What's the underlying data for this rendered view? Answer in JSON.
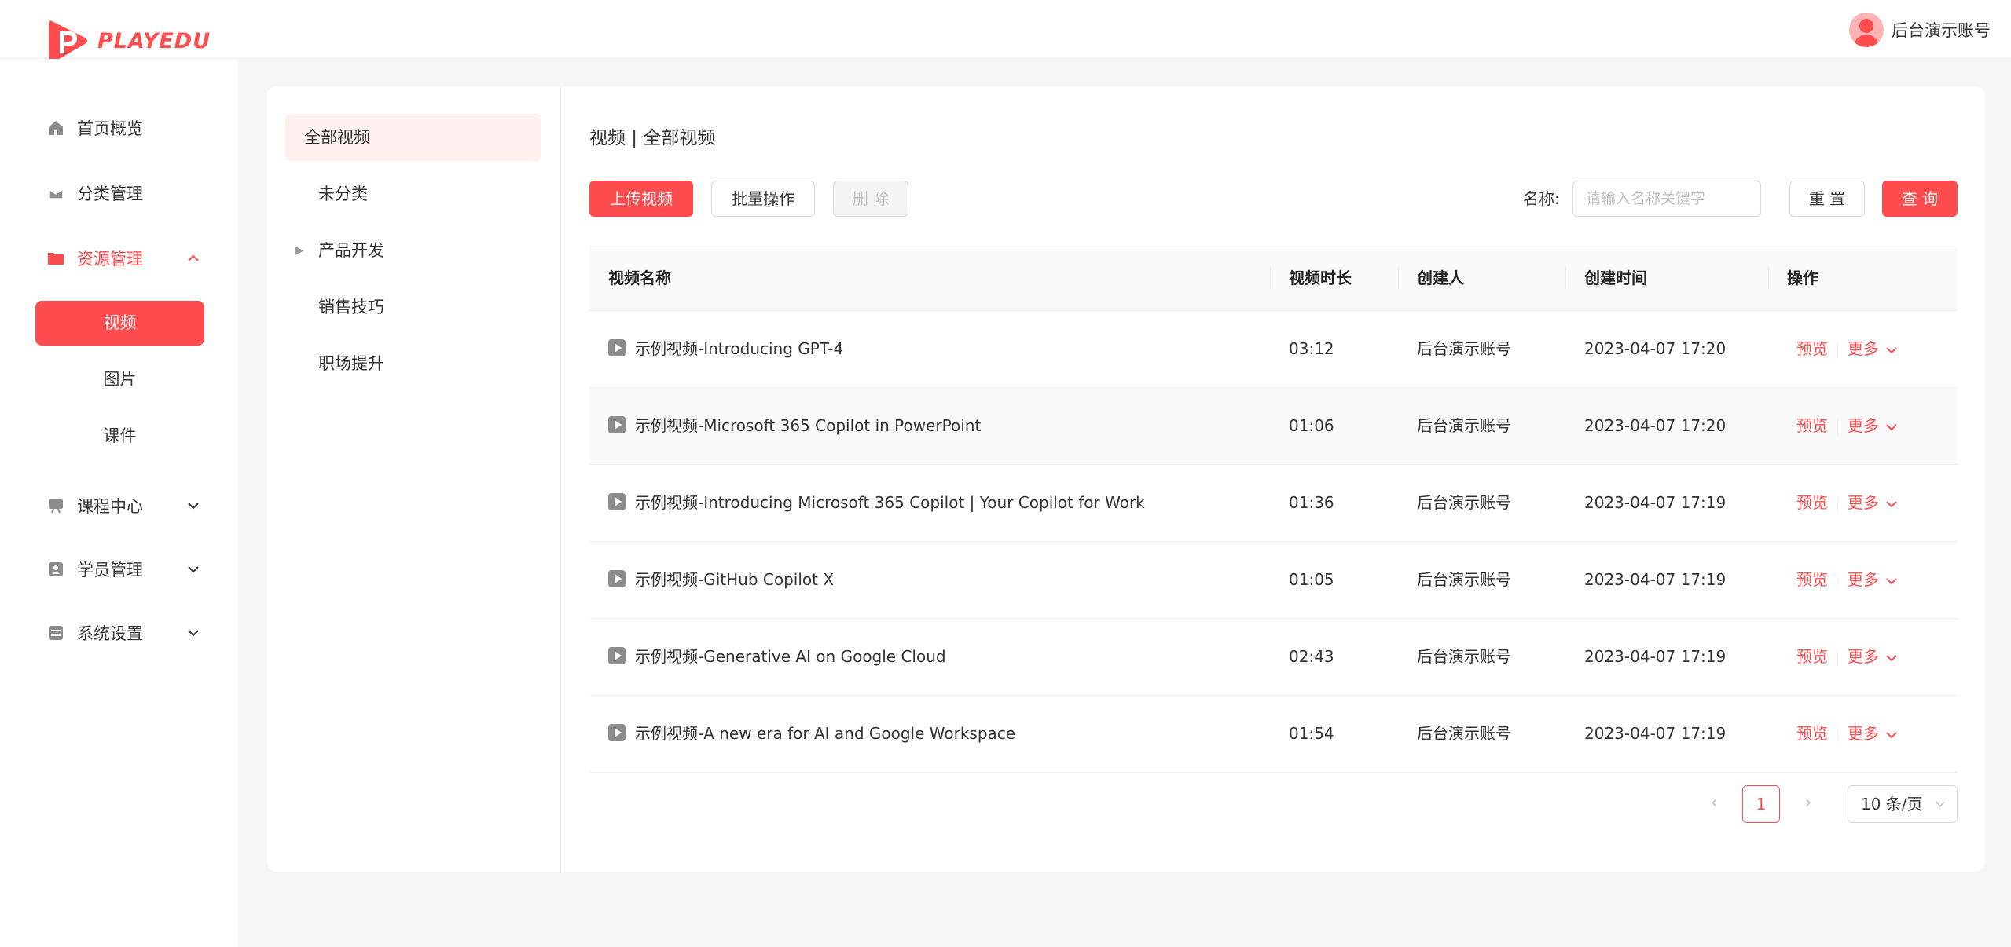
{
  "brand": {
    "name": "PLAYEDU",
    "color": "#ff4d4f"
  },
  "header": {
    "username": "后台演示账号"
  },
  "sidebar": {
    "items": [
      {
        "label": "首页概览",
        "icon": "home-icon"
      },
      {
        "label": "分类管理",
        "icon": "inbox-icon"
      },
      {
        "label": "资源管理",
        "icon": "folder-icon",
        "expanded": true,
        "children": [
          {
            "label": "视频",
            "active": true
          },
          {
            "label": "图片"
          },
          {
            "label": "课件"
          }
        ]
      },
      {
        "label": "课程中心",
        "icon": "course-icon"
      },
      {
        "label": "学员管理",
        "icon": "user-card-icon"
      },
      {
        "label": "系统设置",
        "icon": "settings-icon"
      }
    ]
  },
  "categories": [
    {
      "label": "全部视频",
      "active": true
    },
    {
      "label": "未分类"
    },
    {
      "label": "产品开发",
      "has_children": true
    },
    {
      "label": "销售技巧"
    },
    {
      "label": "职场提升"
    }
  ],
  "main": {
    "breadcrumb": "视频 | 全部视频",
    "toolbar": {
      "upload": "上传视频",
      "batch": "批量操作",
      "delete": "删 除"
    },
    "search": {
      "label": "名称:",
      "placeholder": "请输入名称关键字",
      "reset": "重 置",
      "query": "查 询"
    },
    "table": {
      "headers": [
        "视频名称",
        "视频时长",
        "创建人",
        "创建时间",
        "操作"
      ],
      "rows": [
        {
          "name": "示例视频-Introducing GPT-4",
          "duration": "03:12",
          "creator": "后台演示账号",
          "time": "2023-04-07 17:20"
        },
        {
          "name": "示例视频-Microsoft 365 Copilot in PowerPoint",
          "duration": "01:06",
          "creator": "后台演示账号",
          "time": "2023-04-07 17:20"
        },
        {
          "name": "示例视频-Introducing Microsoft 365 Copilot | Your Copilot for Work",
          "duration": "01:36",
          "creator": "后台演示账号",
          "time": "2023-04-07 17:19"
        },
        {
          "name": "示例视频-GitHub Copilot X",
          "duration": "01:05",
          "creator": "后台演示账号",
          "time": "2023-04-07 17:19"
        },
        {
          "name": "示例视频-Generative AI on Google Cloud",
          "duration": "02:43",
          "creator": "后台演示账号",
          "time": "2023-04-07 17:19"
        },
        {
          "name": "示例视频-A new era for AI and Google Workspace",
          "duration": "01:54",
          "creator": "后台演示账号",
          "time": "2023-04-07 17:19"
        }
      ],
      "actions": {
        "preview": "预览",
        "more": "更多"
      }
    },
    "pagination": {
      "current": "1",
      "page_size": "10 条/页"
    }
  }
}
